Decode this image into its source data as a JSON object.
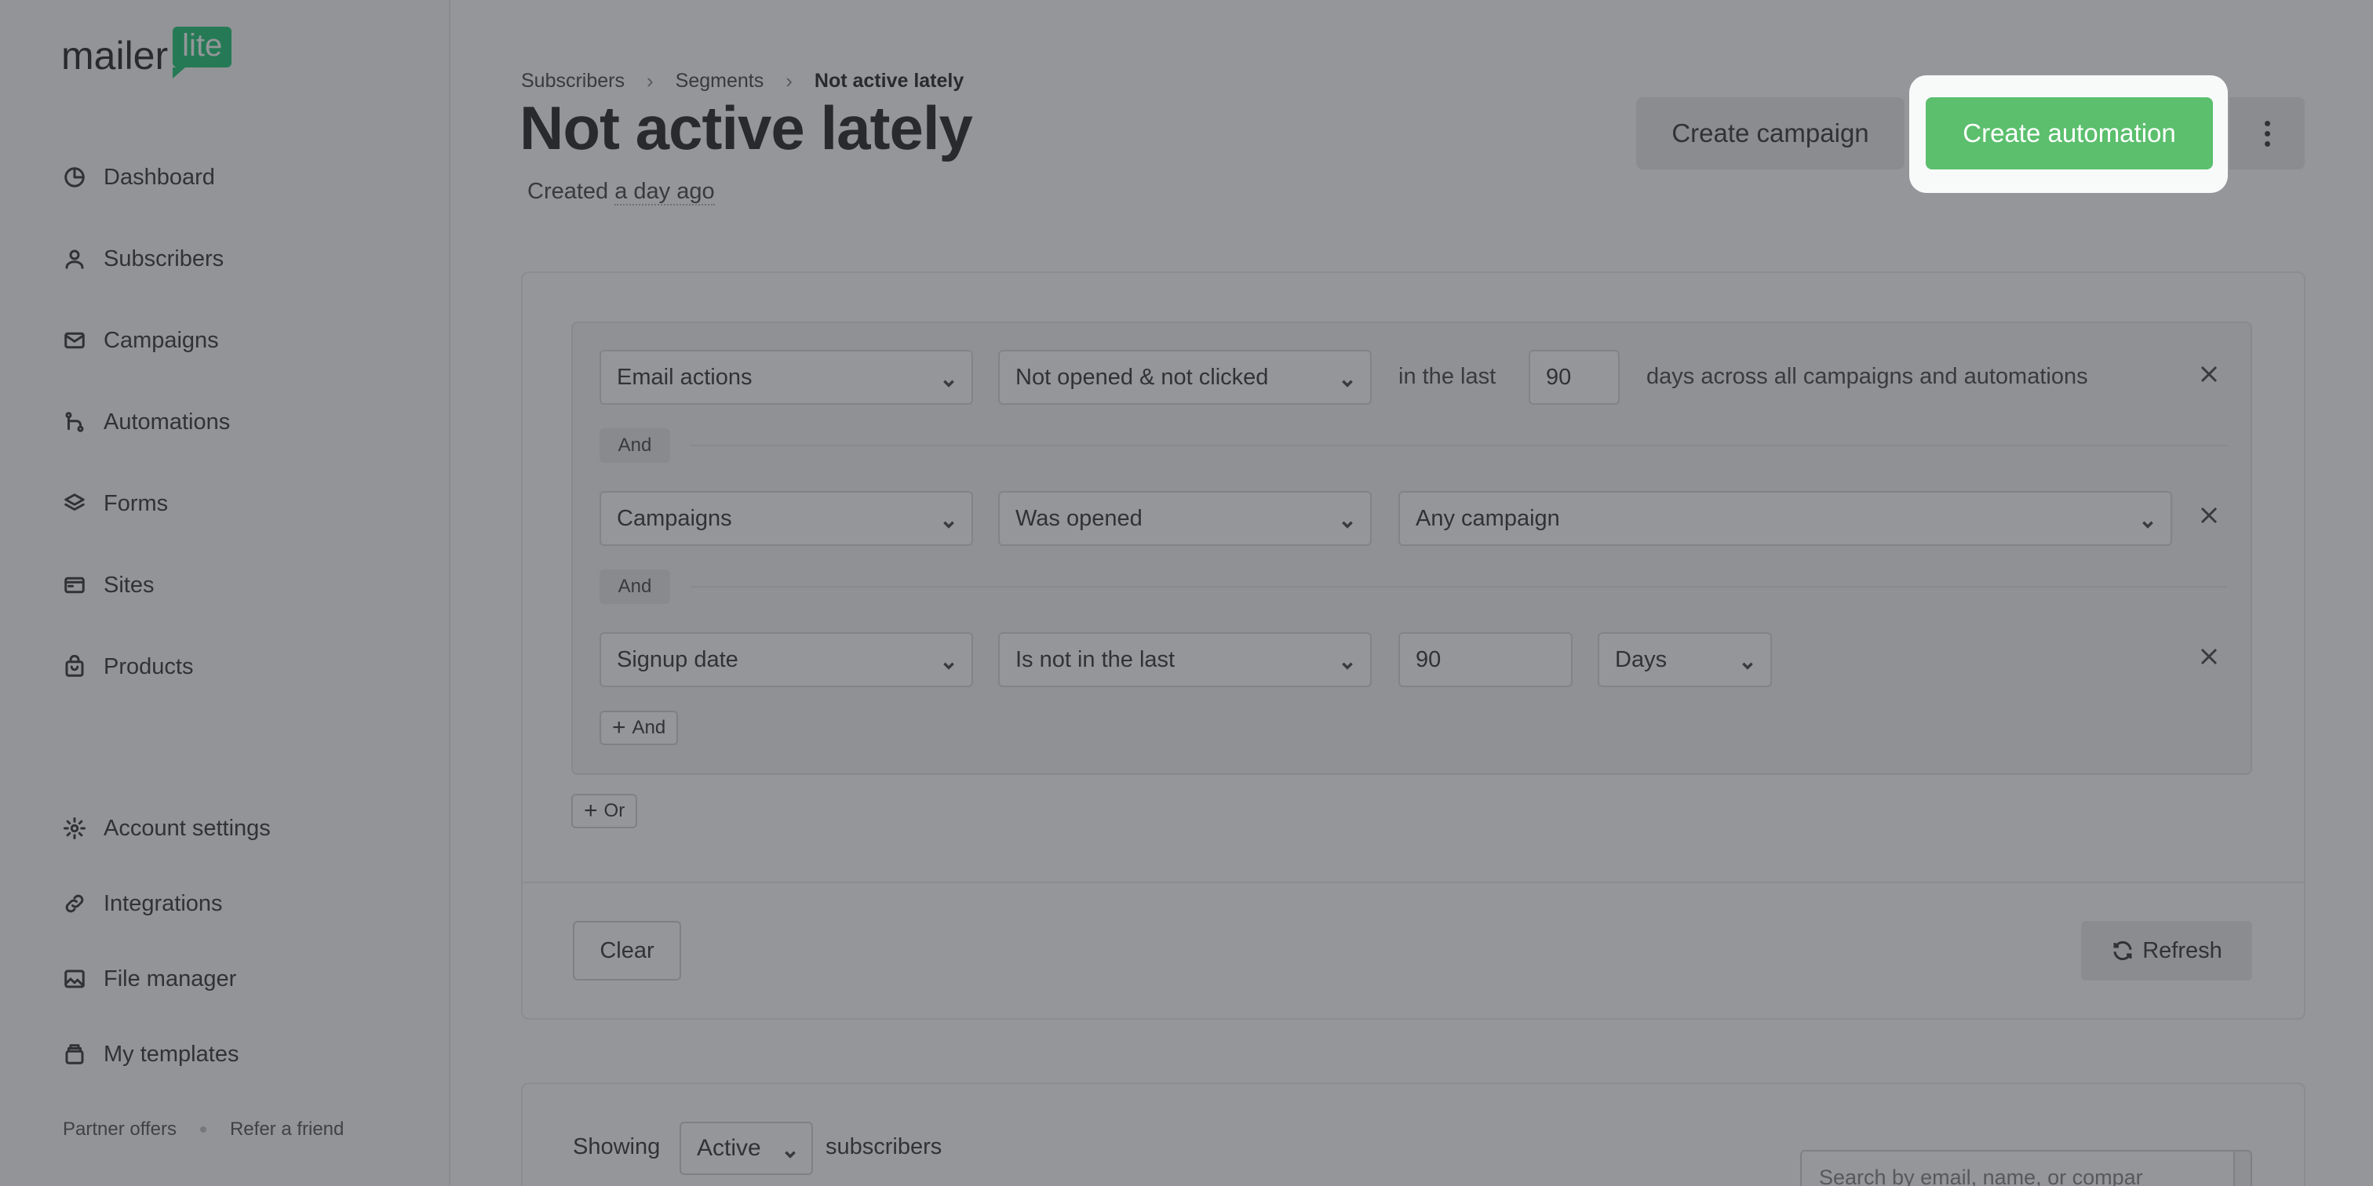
{
  "brand": {
    "word": "mailer",
    "badge": "lite"
  },
  "sidebar": {
    "items": [
      {
        "label": "Dashboard",
        "icon": "dashboard-icon"
      },
      {
        "label": "Subscribers",
        "icon": "user-icon"
      },
      {
        "label": "Campaigns",
        "icon": "mail-icon"
      },
      {
        "label": "Automations",
        "icon": "automation-icon"
      },
      {
        "label": "Forms",
        "icon": "layers-icon"
      },
      {
        "label": "Sites",
        "icon": "browser-icon"
      },
      {
        "label": "Products",
        "icon": "bag-icon"
      }
    ],
    "bottom_items": [
      {
        "label": "Account settings",
        "icon": "gear-icon"
      },
      {
        "label": "Integrations",
        "icon": "link-icon"
      },
      {
        "label": "File manager",
        "icon": "image-icon"
      },
      {
        "label": "My templates",
        "icon": "template-icon"
      }
    ],
    "footer": {
      "partner": "Partner offers",
      "refer": "Refer a friend"
    }
  },
  "breadcrumb": {
    "level1": "Subscribers",
    "level2": "Segments",
    "current": "Not active lately"
  },
  "page": {
    "title": "Not active lately",
    "created_prefix": "Created",
    "created_when": "a day ago"
  },
  "actions": {
    "create_campaign": "Create campaign",
    "create_automation": "Create automation"
  },
  "rules": {
    "row1": {
      "field": "Email actions",
      "condition": "Not opened & not clicked",
      "in_the_last": "in the last",
      "value": "90",
      "suffix": "days across all campaigns and automations"
    },
    "and_label": "And",
    "row2": {
      "field": "Campaigns",
      "condition": "Was opened",
      "target": "Any campaign"
    },
    "row3": {
      "field": "Signup date",
      "condition": "Is not in the last",
      "value": "90",
      "unit": "Days"
    },
    "add_and": "And",
    "add_or": "Or"
  },
  "footer_buttons": {
    "clear": "Clear",
    "refresh": "Refresh"
  },
  "list": {
    "showing": "Showing",
    "status": "Active",
    "subscribers": "subscribers",
    "search_placeholder": "Search by email, name, or compar"
  }
}
